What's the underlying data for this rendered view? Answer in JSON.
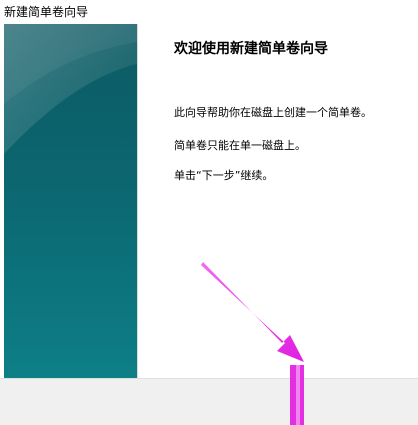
{
  "window": {
    "title": "新建简单卷向导"
  },
  "wizard": {
    "heading": "欢迎使用新建简单卷向导",
    "lines": [
      "此向导帮助你在磁盘上创建一个简单卷。",
      "简单卷只能在单一磁盘上。",
      "单击“下一步”继续。"
    ]
  },
  "footer": {
    "next_label": ""
  },
  "colors": {
    "banner_top": "#0d5a63",
    "banner_bottom": "#0d7f87",
    "annotation_arrow": "#e61ee6"
  },
  "icons": {
    "annotation": "pointer-arrow-icon"
  }
}
